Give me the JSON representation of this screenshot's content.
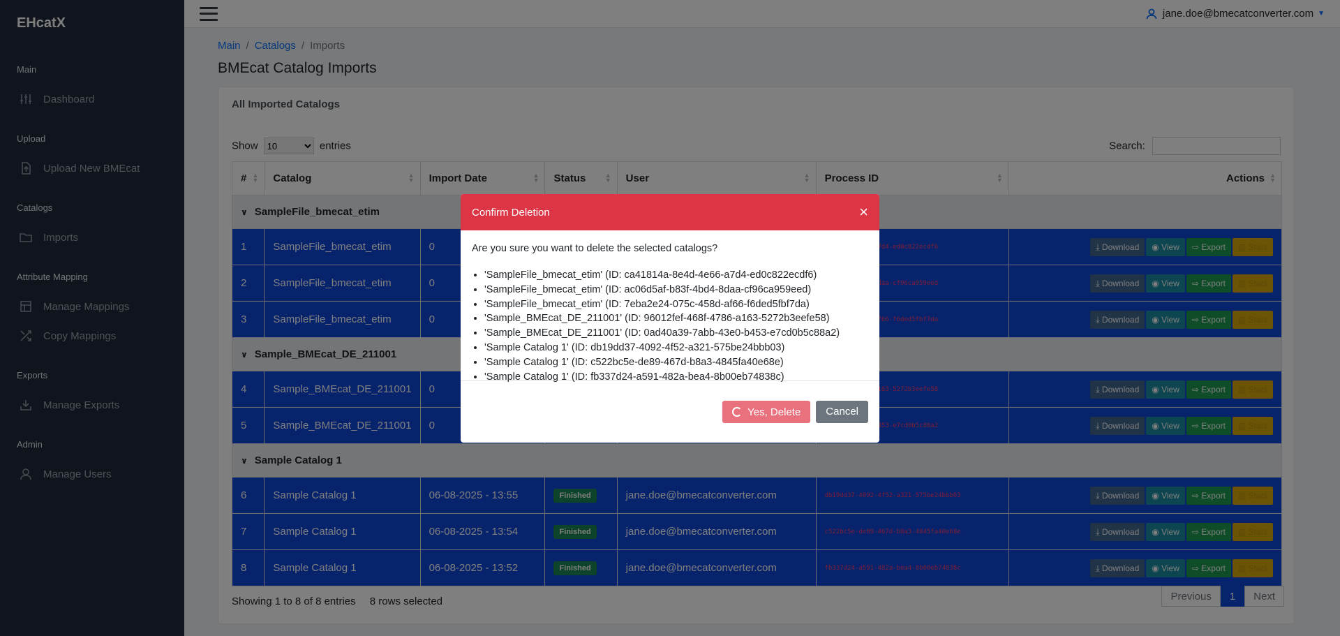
{
  "brand": "EHcatX",
  "sidebar": {
    "sections": [
      {
        "title": "Main",
        "items": [
          {
            "label": "Dashboard",
            "icon": "sliders-icon"
          }
        ]
      },
      {
        "title": "Upload",
        "items": [
          {
            "label": "Upload New BMEcat",
            "icon": "file-upload-icon"
          }
        ]
      },
      {
        "title": "Catalogs",
        "items": [
          {
            "label": "Imports",
            "icon": "folder-icon"
          }
        ]
      },
      {
        "title": "Attribute Mapping",
        "items": [
          {
            "label": "Manage Mappings",
            "icon": "table-icon"
          },
          {
            "label": "Copy Mappings",
            "icon": "shuffle-icon"
          }
        ]
      },
      {
        "title": "Exports",
        "items": [
          {
            "label": "Manage Exports",
            "icon": "download-icon"
          }
        ]
      },
      {
        "title": "Admin",
        "items": [
          {
            "label": "Manage Users",
            "icon": "user-icon"
          }
        ]
      }
    ]
  },
  "topbar": {
    "user": "jane.doe@bmecatconverter.com"
  },
  "breadcrumb": {
    "main": "Main",
    "catalogs": "Catalogs",
    "current": "Imports",
    "sep": "/"
  },
  "page": {
    "title": "BMEcat Catalog Imports"
  },
  "card": {
    "title": "All Imported Catalogs"
  },
  "controls": {
    "show": "Show",
    "entries_value": "10",
    "entries": "entries",
    "search": "Search:"
  },
  "table": {
    "headers": [
      "#",
      "Catalog",
      "Import Date",
      "Status",
      "User",
      "Process ID",
      "Actions"
    ],
    "groups": [
      {
        "name": "SampleFile_bmecat_etim",
        "rows": [
          {
            "n": "1",
            "catalog": "SampleFile_bmecat_etim",
            "date": "0",
            "status": "",
            "user": "",
            "pid": "4d-8e4d-4e66-a7d4-ed0c822ecdf6"
          },
          {
            "n": "2",
            "catalog": "SampleFile_bmecat_etim",
            "date": "0",
            "status": "",
            "user": "",
            "pid": "af-b83f-4bd4-8daa-cf96ca959eed"
          },
          {
            "n": "3",
            "catalog": "SampleFile_bmecat_etim",
            "date": "0",
            "status": "",
            "user": "",
            "pid": "24-075c-458d-af66-f6ded5fbf7da"
          }
        ]
      },
      {
        "name": "Sample_BMEcat_DE_211001",
        "rows": [
          {
            "n": "4",
            "catalog": "Sample_BMEcat_DE_211001",
            "date": "0",
            "status": "",
            "user": "",
            "pid": "ef-468f-4786-a163-5272b3eefe58"
          },
          {
            "n": "5",
            "catalog": "Sample_BMEcat_DE_211001",
            "date": "0",
            "status": "",
            "user": "",
            "pid": "39-7abb-43e0-b453-e7cd0b5c88a2"
          }
        ]
      },
      {
        "name": "Sample Catalog 1",
        "rows": [
          {
            "n": "6",
            "catalog": "Sample Catalog 1",
            "date": "06-08-2025 - 13:55",
            "status": "Finished",
            "user": "jane.doe@bmecatconverter.com",
            "pid": "db19dd37-4092-4f52-a321-575be24bbb03"
          },
          {
            "n": "7",
            "catalog": "Sample Catalog 1",
            "date": "06-08-2025 - 13:54",
            "status": "Finished",
            "user": "jane.doe@bmecatconverter.com",
            "pid": "c522bc5e-de89-467d-b8a3-4845fa40e68e"
          },
          {
            "n": "8",
            "catalog": "Sample Catalog 1",
            "date": "06-08-2025 - 13:52",
            "status": "Finished",
            "user": "jane.doe@bmecatconverter.com",
            "pid": "fb337d24-a591-482a-bea4-8b00eb74838c"
          }
        ]
      }
    ],
    "actions": {
      "download": "Download",
      "view": "View",
      "export": "Export",
      "stats": "Stats"
    }
  },
  "footer": {
    "info": "Showing 1 to 8 of 8 entries",
    "selected": "8 rows selected"
  },
  "pager": {
    "prev": "Previous",
    "page": "1",
    "next": "Next"
  },
  "modal": {
    "title": "Confirm Deletion",
    "close": "×",
    "question": "Are you sure you want to delete the selected catalogs?",
    "items": [
      "'SampleFile_bmecat_etim' (ID: ca41814a-8e4d-4e66-a7d4-ed0c822ecdf6)",
      "'SampleFile_bmecat_etim' (ID: ac06d5af-b83f-4bd4-8daa-cf96ca959eed)",
      "'SampleFile_bmecat_etim' (ID: 7eba2e24-075c-458d-af66-f6ded5fbf7da)",
      "'Sample_BMEcat_DE_211001' (ID: 96012fef-468f-4786-a163-5272b3eefe58)",
      "'Sample_BMEcat_DE_211001' (ID: 0ad40a39-7abb-43e0-b453-e7cd0b5c88a2)",
      "'Sample Catalog 1' (ID: db19dd37-4092-4f52-a321-575be24bbb03)",
      "'Sample Catalog 1' (ID: c522bc5e-de89-467d-b8a3-4845fa40e68e)",
      "'Sample Catalog 1' (ID: fb337d24-a591-482a-bea4-8b00eb74838c)"
    ],
    "confirm": "Yes, Delete",
    "cancel": "Cancel"
  },
  "colors": {
    "sidebar": "#212b3a",
    "danger": "#dc3545",
    "selected_row": "#0d47d9",
    "primary": "#0d6efd"
  }
}
